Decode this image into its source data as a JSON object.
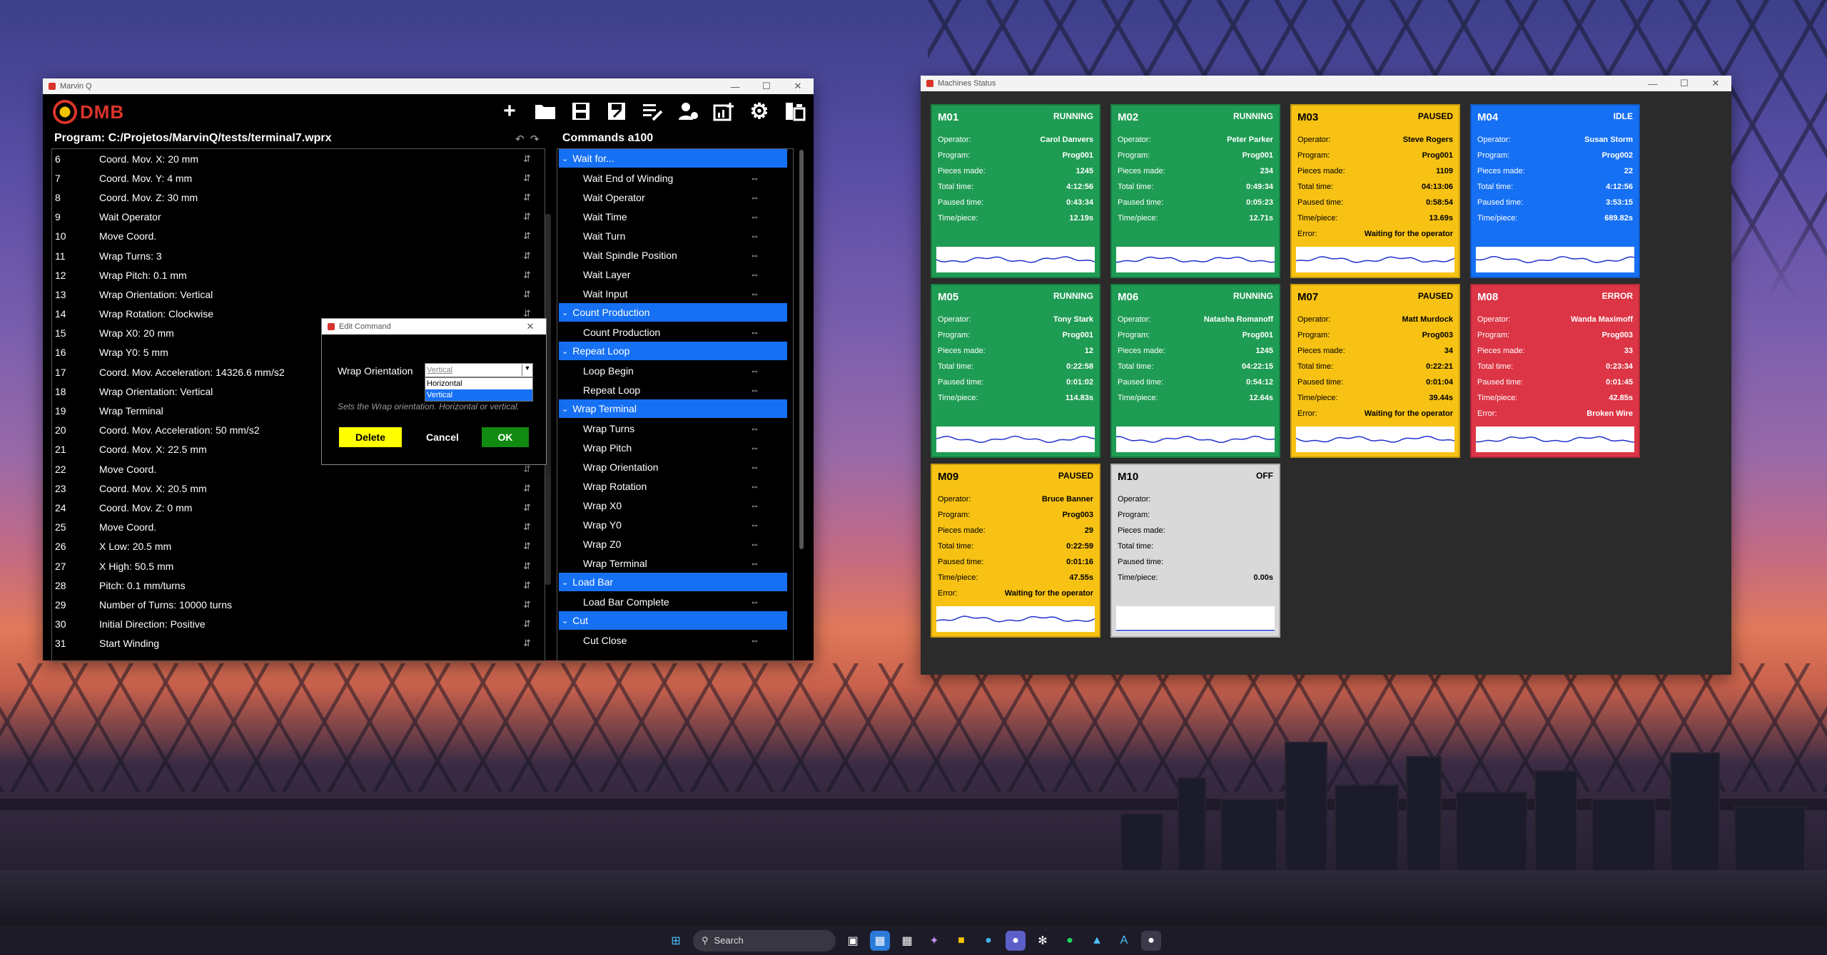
{
  "marvin": {
    "title": "Marvin Q",
    "logo": "DMB",
    "program_path": "Program: C:/Projetos/MarvinQ/tests/terminal7.wprx",
    "commands_title": "Commands a100",
    "toolbar_icons": [
      "add-icon",
      "open-folder-icon",
      "save-icon",
      "save-as-icon",
      "edit-list-icon",
      "operator-icon",
      "add-chart-icon",
      "gear-icon",
      "machine-icon"
    ],
    "lines": [
      {
        "n": "6",
        "t": "Coord. Mov. X: 20 mm"
      },
      {
        "n": "7",
        "t": "Coord. Mov. Y: 4 mm"
      },
      {
        "n": "8",
        "t": "Coord. Mov. Z: 30 mm"
      },
      {
        "n": "9",
        "t": "Wait Operator"
      },
      {
        "n": "10",
        "t": "Move Coord."
      },
      {
        "n": "11",
        "t": "Wrap Turns: 3"
      },
      {
        "n": "12",
        "t": "Wrap Pitch: 0.1 mm"
      },
      {
        "n": "13",
        "t": "Wrap Orientation: Vertical"
      },
      {
        "n": "14",
        "t": "Wrap Rotation: Clockwise"
      },
      {
        "n": "15",
        "t": "Wrap X0: 20 mm"
      },
      {
        "n": "16",
        "t": "Wrap Y0: 5 mm"
      },
      {
        "n": "17",
        "t": "Coord. Mov. Acceleration: 14326.6 mm/s2"
      },
      {
        "n": "18",
        "t": "Wrap Orientation: Vertical"
      },
      {
        "n": "19",
        "t": "Wrap Terminal"
      },
      {
        "n": "20",
        "t": "Coord. Mov. Acceleration: 50 mm/s2"
      },
      {
        "n": "21",
        "t": "Coord. Mov. X: 22.5 mm"
      },
      {
        "n": "22",
        "t": "Move Coord."
      },
      {
        "n": "23",
        "t": "Coord. Mov. X: 20.5 mm"
      },
      {
        "n": "24",
        "t": "Coord. Mov. Z: 0 mm"
      },
      {
        "n": "25",
        "t": "Move Coord."
      },
      {
        "n": "26",
        "t": "X Low: 20.5 mm"
      },
      {
        "n": "27",
        "t": "X High: 50.5 mm"
      },
      {
        "n": "28",
        "t": "Pitch: 0.1 mm/turns"
      },
      {
        "n": "29",
        "t": "Number of Turns: 10000 turns"
      },
      {
        "n": "30",
        "t": "Initial Direction: Positive"
      },
      {
        "n": "31",
        "t": "Start Winding"
      }
    ],
    "command_groups": [
      {
        "name": "Wait for...",
        "items": [
          "Wait End of Winding",
          "Wait Operator",
          "Wait Time",
          "Wait Turn",
          "Wait Spindle Position",
          "Wait Layer",
          "Wait Input"
        ]
      },
      {
        "name": "Count Production",
        "items": [
          "Count Production"
        ]
      },
      {
        "name": "Repeat Loop",
        "items": [
          "Loop Begin",
          "Repeat Loop"
        ]
      },
      {
        "name": "Wrap Terminal",
        "items": [
          "Wrap Turns",
          "Wrap Pitch",
          "Wrap Orientation",
          "Wrap Rotation",
          "Wrap X0",
          "Wrap Y0",
          "Wrap Z0",
          "Wrap Terminal"
        ]
      },
      {
        "name": "Load Bar",
        "items": [
          "Load Bar Complete"
        ]
      },
      {
        "name": "Cut",
        "items": [
          "Cut Close"
        ]
      }
    ]
  },
  "edit_dialog": {
    "title": "Edit Command",
    "label": "Wrap Orientation",
    "selected": "Vertical",
    "options": [
      "Horizontal",
      "Vertical"
    ],
    "help": "Sets the Wrap orientation. Horizontal or vertical.",
    "delete": "Delete",
    "cancel": "Cancel",
    "ok": "OK"
  },
  "machines": {
    "title": "Machines Status",
    "labels": {
      "operator": "Operator:",
      "program": "Program:",
      "pieces": "Pieces made:",
      "total": "Total time:",
      "paused": "Paused time:",
      "tpp": "Time/piece:",
      "error": "Error:"
    },
    "list": [
      {
        "id": "M01",
        "status": "RUNNING",
        "cls": "running",
        "operator": "Carol Danvers",
        "program": "Prog001",
        "pieces": "1245",
        "total": "4:12:56",
        "paused": "0:43:34",
        "tpp": "12.19s",
        "error": null
      },
      {
        "id": "M02",
        "status": "RUNNING",
        "cls": "running",
        "operator": "Peter Parker",
        "program": "Prog001",
        "pieces": "234",
        "total": "0:49:34",
        "paused": "0:05:23",
        "tpp": "12.71s",
        "error": null
      },
      {
        "id": "M03",
        "status": "PAUSED",
        "cls": "paused",
        "operator": "Steve Rogers",
        "program": "Prog001",
        "pieces": "1109",
        "total": "04:13:06",
        "paused": "0:58:54",
        "tpp": "13.69s",
        "error": "Waiting for the operator"
      },
      {
        "id": "M04",
        "status": "IDLE",
        "cls": "idle",
        "operator": "Susan Storm",
        "program": "Prog002",
        "pieces": "22",
        "total": "4:12:56",
        "paused": "3:53:15",
        "tpp": "689.82s",
        "error": null
      },
      {
        "id": "M05",
        "status": "RUNNING",
        "cls": "running",
        "operator": "Tony Stark",
        "program": "Prog001",
        "pieces": "12",
        "total": "0:22:58",
        "paused": "0:01:02",
        "tpp": "114.83s",
        "error": null
      },
      {
        "id": "M06",
        "status": "RUNNING",
        "cls": "running",
        "operator": "Natasha Romanoff",
        "program": "Prog001",
        "pieces": "1245",
        "total": "04:22:15",
        "paused": "0:54:12",
        "tpp": "12.64s",
        "error": null
      },
      {
        "id": "M07",
        "status": "PAUSED",
        "cls": "paused",
        "operator": "Matt Murdock",
        "program": "Prog003",
        "pieces": "34",
        "total": "0:22:21",
        "paused": "0:01:04",
        "tpp": "39.44s",
        "error": "Waiting for the operator"
      },
      {
        "id": "M08",
        "status": "ERROR",
        "cls": "error",
        "operator": "Wanda Maximoff",
        "program": "Prog003",
        "pieces": "33",
        "total": "0:23:34",
        "paused": "0:01:45",
        "tpp": "42.85s",
        "error": "Broken Wire"
      },
      {
        "id": "M09",
        "status": "PAUSED",
        "cls": "paused",
        "operator": "Bruce Banner",
        "program": "Prog003",
        "pieces": "29",
        "total": "0:22:59",
        "paused": "0:01:16",
        "tpp": "47.55s",
        "error": "Waiting for the operator"
      },
      {
        "id": "M10",
        "status": "OFF",
        "cls": "off",
        "operator": "",
        "program": "",
        "pieces": "",
        "total": "",
        "paused": "",
        "tpp": "0.00s",
        "error": null
      }
    ]
  },
  "taskbar": {
    "search": "Search"
  },
  "colors": {
    "running": "#1f9c53",
    "paused": "#f7c213",
    "idle": "#1670f3",
    "error": "#dc3545",
    "off": "#d9d9d9",
    "category": "#1670f3"
  }
}
